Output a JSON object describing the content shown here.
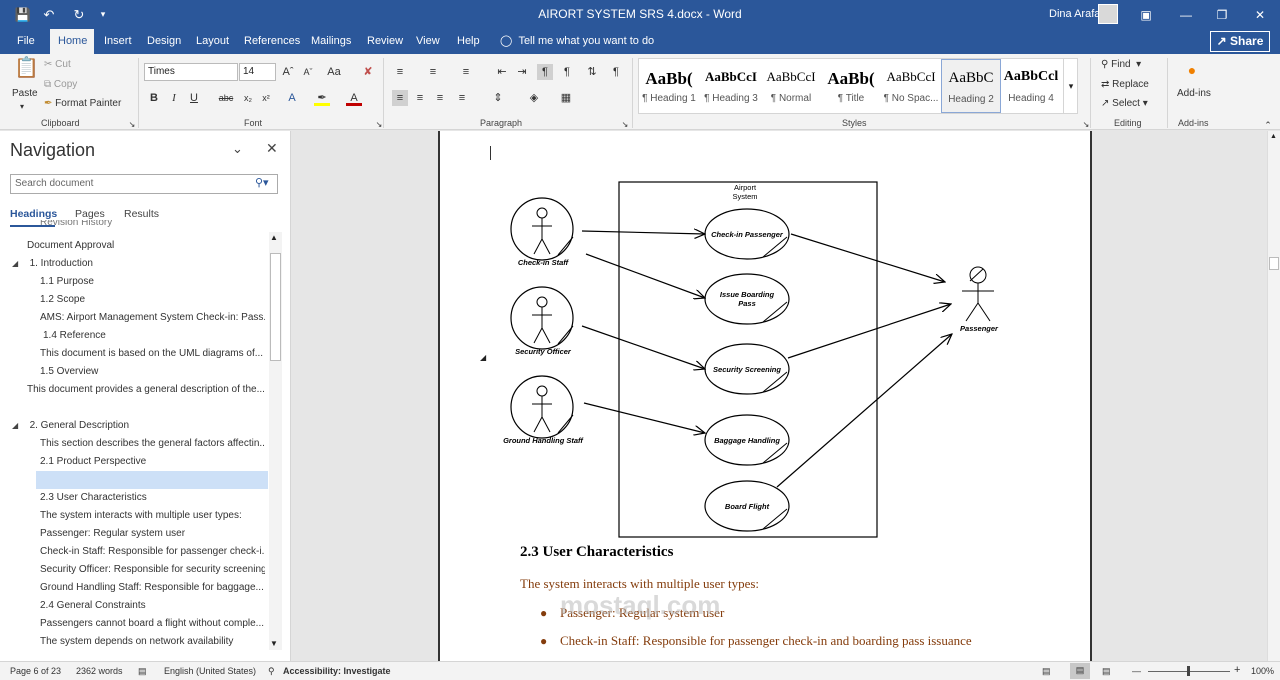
{
  "window": {
    "title": "AIRORT SYSTEM SRS 4.docx  -  Word",
    "user": "Dina Arafa"
  },
  "tabs": [
    "File",
    "Home",
    "Insert",
    "Design",
    "Layout",
    "References",
    "Mailings",
    "Review",
    "View",
    "Help"
  ],
  "tell_me": "Tell me what you want to do",
  "share": "Share",
  "ribbon": {
    "clipboard": {
      "paste": "Paste",
      "cut": "Cut",
      "copy": "Copy",
      "format_painter": "Format Painter",
      "label": "Clipboard"
    },
    "font": {
      "name": "Times",
      "size": "14",
      "label": "Font"
    },
    "paragraph": {
      "label": "Paragraph"
    },
    "styles": {
      "label": "Styles",
      "items": [
        {
          "sample": "AaBb(",
          "name": "¶ Heading 1"
        },
        {
          "sample": "AaBbCcI",
          "name": "¶ Heading 3"
        },
        {
          "sample": "AaBbCcI",
          "name": "¶ Normal"
        },
        {
          "sample": "AaBb(",
          "name": "¶ Title"
        },
        {
          "sample": "AaBbCcI",
          "name": "¶ No Spac..."
        },
        {
          "sample": "AaBbC",
          "name": "Heading 2"
        },
        {
          "sample": "AaBbCcl",
          "name": "Heading 4"
        }
      ]
    },
    "editing": {
      "find": "Find",
      "replace": "Replace",
      "select": "Select",
      "label": "Editing"
    },
    "addins": {
      "button": "Add-ins",
      "label": "Add-ins"
    }
  },
  "nav": {
    "title": "Navigation",
    "search_placeholder": "Search document",
    "tabs": [
      "Headings",
      "Pages",
      "Results"
    ],
    "items": [
      "Revision History",
      "Document Approval",
      "1. Introduction",
      "1.1 Purpose",
      "1.2 Scope",
      "AMS: Airport Management System Check-in: Pass...",
      "1.4 Reference",
      "This document is based on the UML diagrams of...",
      "1.5 Overview",
      "This document provides a general description of the...",
      "2. General Description",
      "This section describes the general factors affectin...",
      "2.1 Product Perspective",
      "",
      "2.3 User Characteristics",
      "The system interacts with multiple user types:",
      "Passenger: Regular system user",
      "Check-in Staff: Responsible for passenger check-i...",
      "Security Officer: Responsible for security screening",
      "Ground Handling Staff: Responsible for baggage...",
      "2.4 General Constraints",
      "Passengers cannot board a flight without comple...",
      "The system depends on network availability"
    ]
  },
  "diagram": {
    "system_label": [
      "Airport",
      "System"
    ],
    "actors_left": [
      "Check-in Staff",
      "Security Officer",
      "Ground Handling Staff"
    ],
    "actor_right": "Passenger",
    "use_cases": [
      [
        "Check-in Passenger"
      ],
      [
        "Issue Boarding",
        "Pass"
      ],
      [
        "Security Screening"
      ],
      [
        "Baggage Handling"
      ],
      [
        "Board Flight"
      ]
    ]
  },
  "document": {
    "heading": "2.3 User Characteristics",
    "intro": "The system interacts with multiple user types:",
    "bullets": [
      "Passenger: Regular system user",
      "Check-in Staff: Responsible for passenger check-in and boarding pass issuance"
    ],
    "watermark": "mostaql.com"
  },
  "status": {
    "page": "Page 6 of 23",
    "words": "2362 words",
    "language": "English (United States)",
    "accessibility": "Accessibility: Investigate",
    "zoom": "100%"
  }
}
